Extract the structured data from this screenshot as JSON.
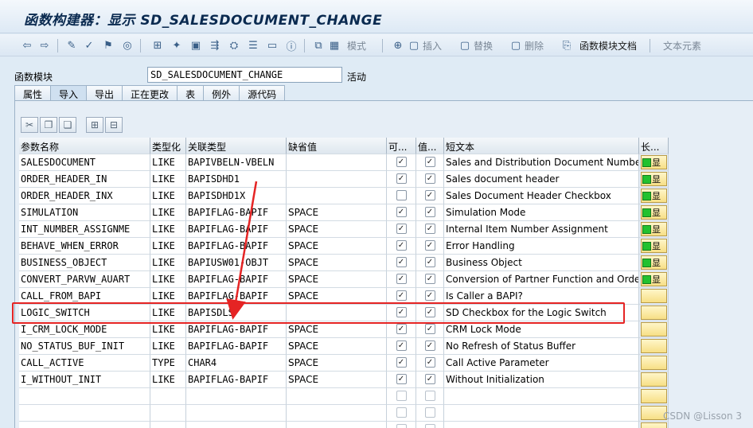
{
  "window": {
    "title": "函数构建器：显示 SD_SALESDOCUMENT_CHANGE"
  },
  "toolbar": {
    "mode_label": "模式",
    "insert_label": "插入",
    "replace_label": "替换",
    "delete_label": "删除",
    "fm_doc_label": "函数模块文档",
    "text_elements_label": "文本元素"
  },
  "function_module": {
    "label": "函数模块",
    "value": "SD_SALESDOCUMENT_CHANGE",
    "status": "活动"
  },
  "tabs": [
    "属性",
    "导入",
    "导出",
    "正在更改",
    "表",
    "例外",
    "源代码"
  ],
  "table": {
    "headers": [
      "参数名称",
      "类型化",
      "关联类型",
      "缺省值",
      "可...",
      "值...",
      "短文本",
      "长..."
    ],
    "long_text_button_label": "显",
    "rows": [
      {
        "name": "SALESDOCUMENT",
        "typing": "LIKE",
        "ref": "BAPIVBELN-VBELN",
        "default": "",
        "optional": true,
        "value": true,
        "text": "Sales and Distribution Document Number",
        "long": true
      },
      {
        "name": "ORDER_HEADER_IN",
        "typing": "LIKE",
        "ref": "BAPISDHD1",
        "default": "",
        "optional": true,
        "value": true,
        "text": "Sales document header",
        "long": true
      },
      {
        "name": "ORDER_HEADER_INX",
        "typing": "LIKE",
        "ref": "BAPISDHD1X",
        "default": "",
        "optional": false,
        "value": true,
        "text": "Sales Document Header Checkbox",
        "long": true
      },
      {
        "name": "SIMULATION",
        "typing": "LIKE",
        "ref": "BAPIFLAG-BAPIF",
        "default": "SPACE",
        "optional": true,
        "value": true,
        "text": "Simulation Mode",
        "long": true
      },
      {
        "name": "INT_NUMBER_ASSIGNME",
        "typing": "LIKE",
        "ref": "BAPIFLAG-BAPIF",
        "default": "SPACE",
        "optional": true,
        "value": true,
        "text": "Internal Item Number Assignment",
        "long": true
      },
      {
        "name": "BEHAVE_WHEN_ERROR",
        "typing": "LIKE",
        "ref": "BAPIFLAG-BAPIF",
        "default": "SPACE",
        "optional": true,
        "value": true,
        "text": "Error Handling",
        "long": true
      },
      {
        "name": "BUSINESS_OBJECT",
        "typing": "LIKE",
        "ref": "BAPIUSW01-OBJT",
        "default": "SPACE",
        "optional": true,
        "value": true,
        "text": "Business Object",
        "long": true
      },
      {
        "name": "CONVERT_PARVW_AUART",
        "typing": "LIKE",
        "ref": "BAPIFLAG-BAPIF",
        "default": "SPACE",
        "optional": true,
        "value": true,
        "text": "Conversion of Partner Function and Order",
        "long": true
      },
      {
        "name": "CALL_FROM_BAPI",
        "typing": "LIKE",
        "ref": "BAPIFLAG-BAPIF",
        "default": "SPACE",
        "optional": true,
        "value": true,
        "text": "Is Caller a BAPI?",
        "long": false
      },
      {
        "name": "LOGIC_SWITCH",
        "typing": "LIKE",
        "ref": "BAPISDLS",
        "default": "",
        "optional": true,
        "value": true,
        "text": "SD Checkbox for the Logic Switch",
        "long": false
      },
      {
        "name": "I_CRM_LOCK_MODE",
        "typing": "LIKE",
        "ref": "BAPIFLAG-BAPIF",
        "default": "SPACE",
        "optional": true,
        "value": true,
        "text": "CRM Lock Mode",
        "long": false
      },
      {
        "name": "NO_STATUS_BUF_INIT",
        "typing": "LIKE",
        "ref": "BAPIFLAG-BAPIF",
        "default": "SPACE",
        "optional": true,
        "value": true,
        "text": "No Refresh of Status Buffer",
        "long": false
      },
      {
        "name": "CALL_ACTIVE",
        "typing": "TYPE",
        "ref": "CHAR4",
        "default": "SPACE",
        "optional": true,
        "value": true,
        "text": "Call Active Parameter",
        "long": false
      },
      {
        "name": "I_WITHOUT_INIT",
        "typing": "LIKE",
        "ref": "BAPIFLAG-BAPIF",
        "default": "SPACE",
        "optional": true,
        "value": true,
        "text": "Without Initialization",
        "long": false
      }
    ],
    "empty_rows": 3
  },
  "watermark": "CSDN @Lisson 3",
  "colors": {
    "highlight_border": "#e52424",
    "background": "#dfebf5",
    "long_text_green": "#22c12f"
  }
}
